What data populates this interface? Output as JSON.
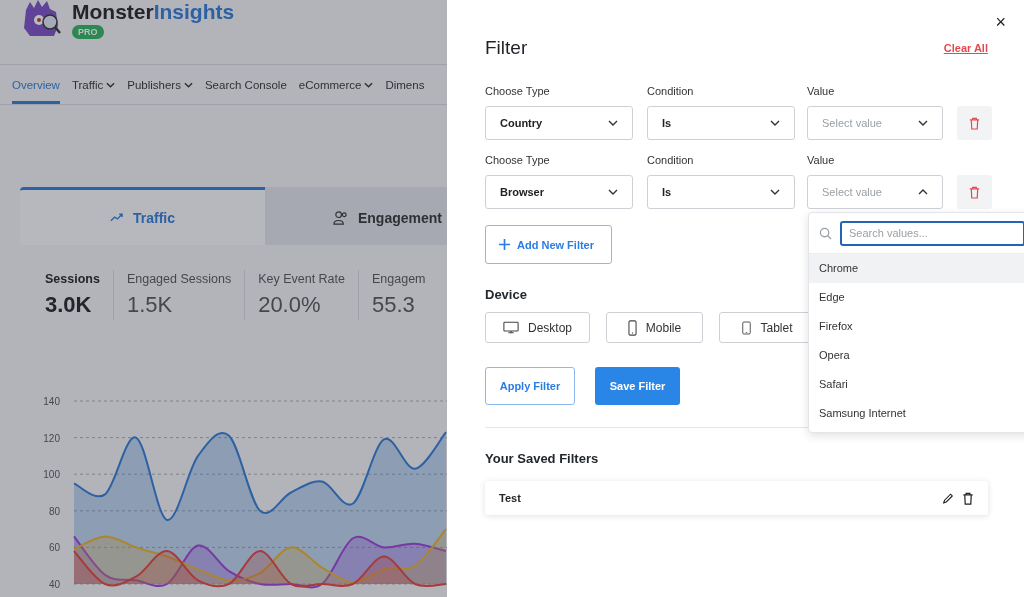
{
  "header": {
    "brand": [
      "Monster",
      "Insights"
    ],
    "badge": "PRO"
  },
  "nav": [
    {
      "label": "Overview",
      "selected": true,
      "has_menu": false
    },
    {
      "label": "Traffic",
      "selected": false,
      "has_menu": true
    },
    {
      "label": "Publishers",
      "selected": false,
      "has_menu": true
    },
    {
      "label": "Search Console",
      "selected": false,
      "has_menu": false
    },
    {
      "label": "eCommerce",
      "selected": false,
      "has_menu": true
    },
    {
      "label": "Dimens",
      "selected": false,
      "has_menu": false
    }
  ],
  "report_tabs": [
    {
      "label": "Traffic",
      "selected": true
    },
    {
      "label": "Engagement",
      "selected": false
    }
  ],
  "metrics": [
    {
      "label": "Sessions",
      "value": "3.0K",
      "selected": true
    },
    {
      "label": "Engaged Sessions",
      "value": "1.5K",
      "selected": false
    },
    {
      "label": "Key Event Rate",
      "value": "20.0%",
      "selected": false
    },
    {
      "label": "Engagem",
      "value": "55.3",
      "selected": false
    }
  ],
  "chart": {
    "chart_data": {
      "type": "area",
      "grid": true,
      "ylim": [
        40,
        140
      ],
      "yticks": [
        40,
        60,
        80,
        100,
        120,
        140
      ],
      "series": [
        {
          "color": "#2f7bd4",
          "values": [
            95,
            89,
            120,
            75,
            110,
            121,
            80,
            90,
            96,
            84,
            119,
            103,
            123
          ]
        },
        {
          "color": "#9b3fd6",
          "values": [
            66,
            45,
            42,
            40,
            61,
            47,
            40,
            40,
            40,
            65,
            60,
            62,
            58
          ]
        },
        {
          "color": "#e8b12a",
          "values": [
            59,
            66,
            60,
            55,
            48,
            42,
            46,
            60,
            49,
            41,
            48,
            50,
            70
          ]
        },
        {
          "color": "#e0433a",
          "values": [
            58,
            40,
            44,
            58,
            42,
            40,
            58,
            40,
            40,
            40,
            55,
            40,
            40
          ]
        }
      ]
    }
  },
  "filter_panel": {
    "close": "×",
    "title": "Filter",
    "clear_all": "Clear All",
    "rows": [
      {
        "type_label": "Choose Type",
        "type": "Country",
        "condition_label": "Condition",
        "condition": "Is",
        "value_label": "Value",
        "value_placeholder": "Select value",
        "expanded": false
      },
      {
        "type_label": "Choose Type",
        "type": "Browser",
        "condition_label": "Condition",
        "condition": "Is",
        "value_label": "Value",
        "value_placeholder": "Select value",
        "expanded": true
      }
    ],
    "add_button": "Add New Filter",
    "device_heading": "Device",
    "devices": [
      {
        "label": "Desktop"
      },
      {
        "label": "Mobile"
      },
      {
        "label": "Tablet"
      }
    ],
    "apply_button": "Apply Filter",
    "save_button": "Save Filter",
    "saved_heading": "Your Saved Filters",
    "saved_filters": [
      {
        "name": "Test"
      }
    ],
    "dropdown": {
      "placeholder": "Search values...",
      "options": [
        {
          "label": "Chrome",
          "selected": true
        },
        {
          "label": "Edge",
          "selected": false
        },
        {
          "label": "Firefox",
          "selected": false
        },
        {
          "label": "Opera",
          "selected": false
        },
        {
          "label": "Safari",
          "selected": false
        },
        {
          "label": "Samsung Internet",
          "selected": false
        }
      ]
    }
  }
}
